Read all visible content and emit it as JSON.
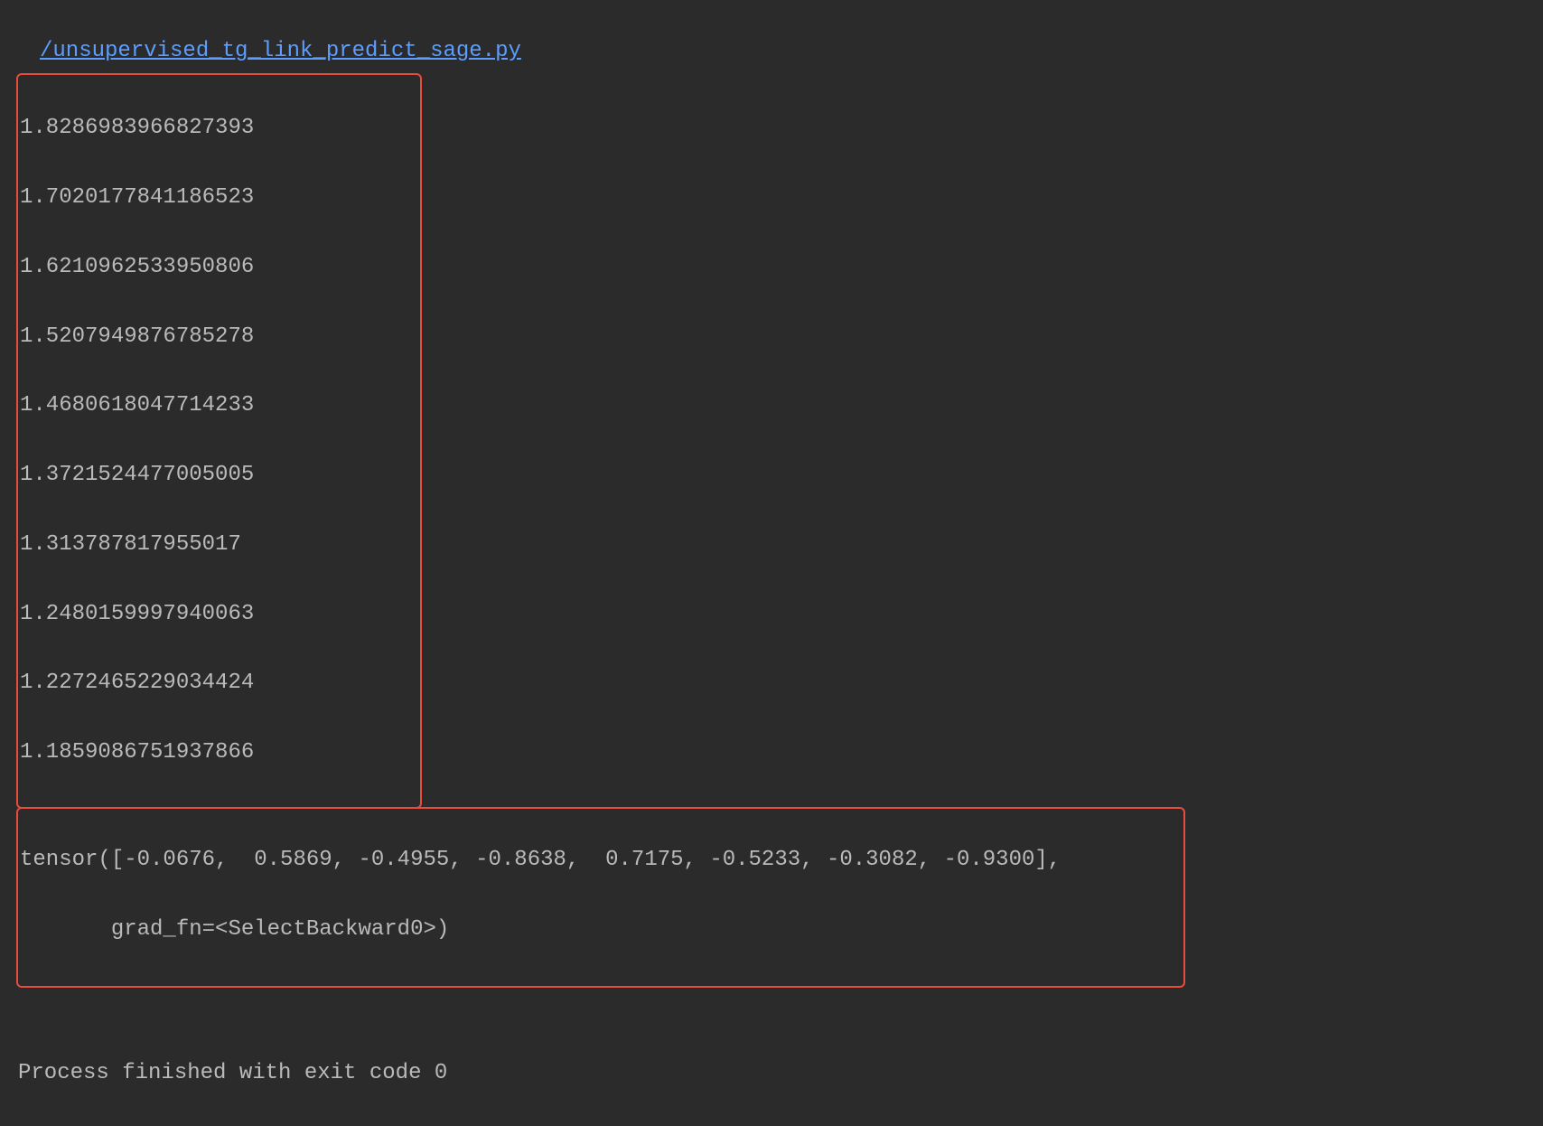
{
  "fileLink": "/unsupervised_tg_link_predict_sage.py",
  "lossValues": [
    "1.8286983966827393",
    "1.7020177841186523",
    "1.6210962533950806",
    "1.5207949876785278",
    "1.4680618047714233",
    "1.3721524477005005",
    "1.313787817955017",
    "1.2480159997940063",
    "1.2272465229034424",
    "1.1859086751937866"
  ],
  "tensorOutput": {
    "line1": "tensor([-0.0676,  0.5869, -0.4955, -0.8638,  0.7175, -0.5233, -0.3082, -0.9300],",
    "line2": "       grad_fn=<SelectBackward0>)"
  },
  "exitStatus": "Process finished with exit code 0"
}
